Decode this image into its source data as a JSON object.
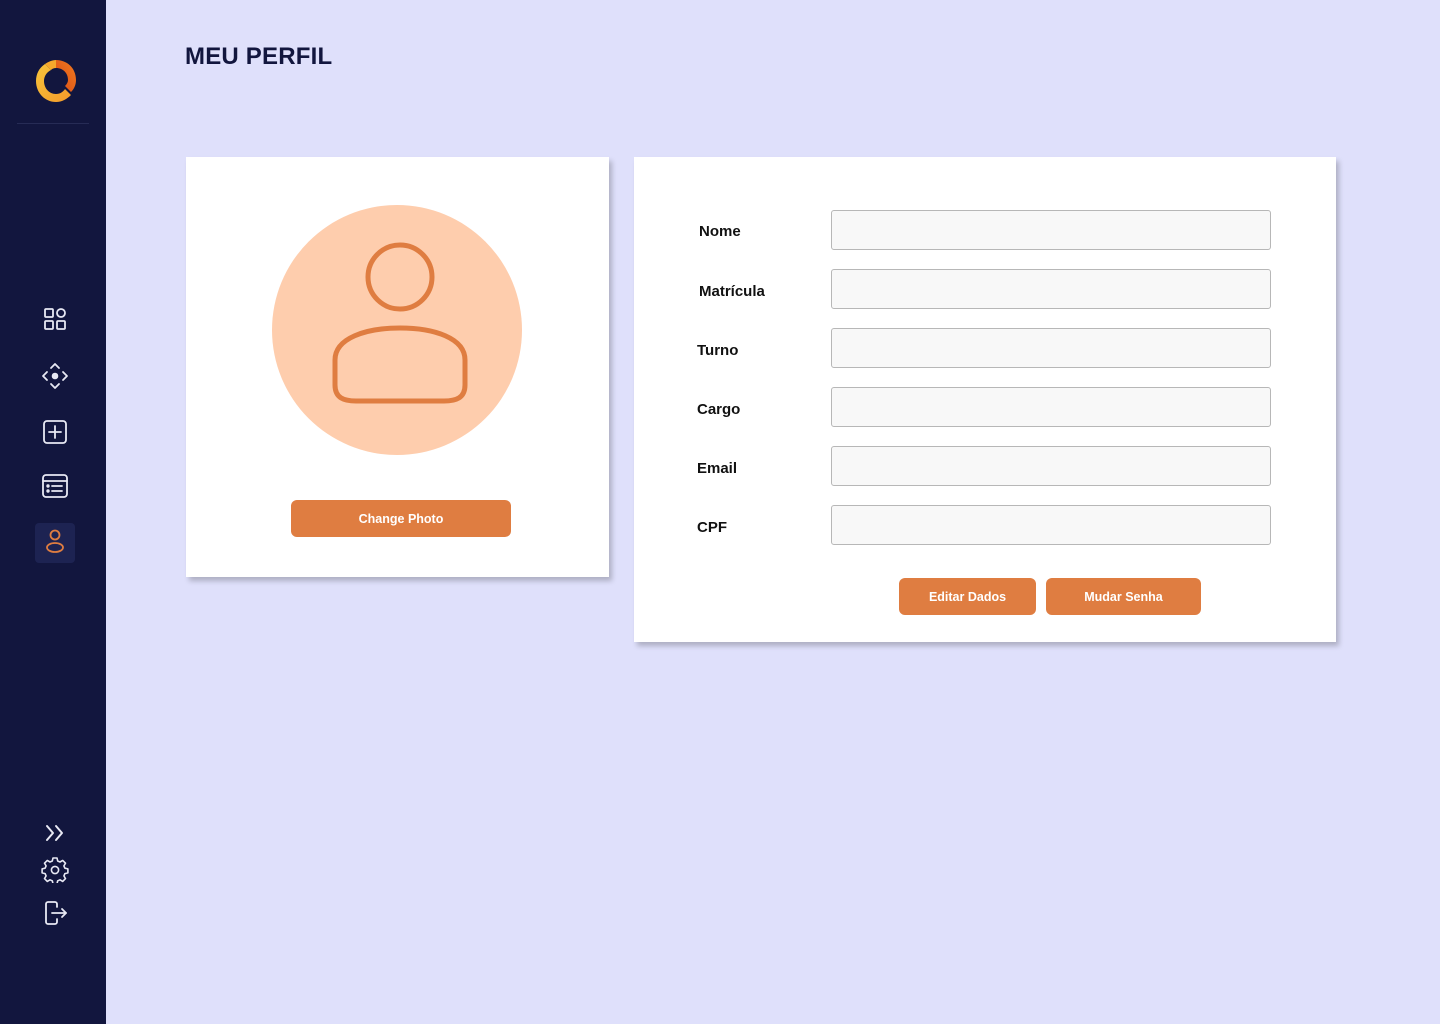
{
  "page": {
    "title": "MEU PERFIL"
  },
  "colors": {
    "background": "#dfe0fb",
    "sidebar": "#12163e",
    "accent": "#df7d41",
    "avatar_bg": "#fecdad",
    "avatar_stroke": "#df7d41"
  },
  "sidebar": {
    "items": [
      {
        "name": "dashboard",
        "icon": "grid-icon",
        "active": false
      },
      {
        "name": "navigate",
        "icon": "diamond-arrows-icon",
        "active": false
      },
      {
        "name": "add",
        "icon": "plus-square-icon",
        "active": false
      },
      {
        "name": "list",
        "icon": "list-panel-icon",
        "active": false
      },
      {
        "name": "profile",
        "icon": "user-icon",
        "active": true
      }
    ],
    "bottom": [
      {
        "name": "expand",
        "icon": "chevrons-right-icon"
      },
      {
        "name": "settings",
        "icon": "gear-icon"
      },
      {
        "name": "logout",
        "icon": "logout-icon"
      }
    ]
  },
  "photo_card": {
    "change_photo_label": "Change Photo"
  },
  "form": {
    "fields": [
      {
        "label": "Nome",
        "value": ""
      },
      {
        "label": "Matrícula",
        "value": ""
      },
      {
        "label": "Turno",
        "value": ""
      },
      {
        "label": "Cargo",
        "value": ""
      },
      {
        "label": "Email",
        "value": ""
      },
      {
        "label": "CPF",
        "value": ""
      }
    ],
    "edit_label": "Editar Dados",
    "password_label": "Mudar Senha"
  }
}
